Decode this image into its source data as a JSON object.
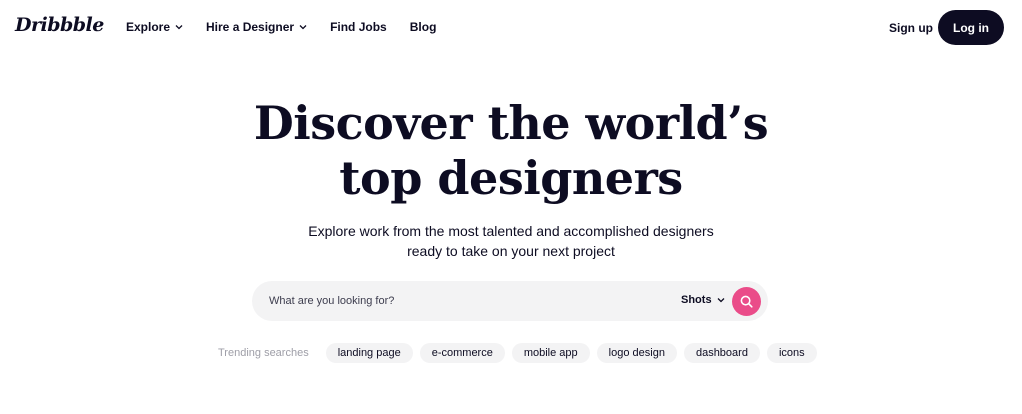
{
  "header": {
    "logo": "Dribbble",
    "nav": [
      {
        "label": "Explore",
        "has_dropdown": true
      },
      {
        "label": "Hire a Designer",
        "has_dropdown": true
      },
      {
        "label": "Find Jobs",
        "has_dropdown": false
      },
      {
        "label": "Blog",
        "has_dropdown": false
      }
    ],
    "signup_label": "Sign up",
    "login_label": "Log in"
  },
  "hero": {
    "title_line1": "Discover the world’s",
    "title_line2": "top designers",
    "subtitle_line1": "Explore work from the most talented and accomplished designers",
    "subtitle_line2": "ready to take on your next project"
  },
  "search": {
    "placeholder": "What are you looking for?",
    "value": "",
    "scope_label": "Shots",
    "icon": "search-icon"
  },
  "trending": {
    "label": "Trending searches",
    "tags": [
      "landing page",
      "e-commerce",
      "mobile app",
      "logo design",
      "dashboard",
      "icons"
    ]
  },
  "colors": {
    "text": "#0d0c22",
    "accent": "#ea4c89",
    "search_bg": "#f3f3f4",
    "muted": "#9e9ea7"
  }
}
